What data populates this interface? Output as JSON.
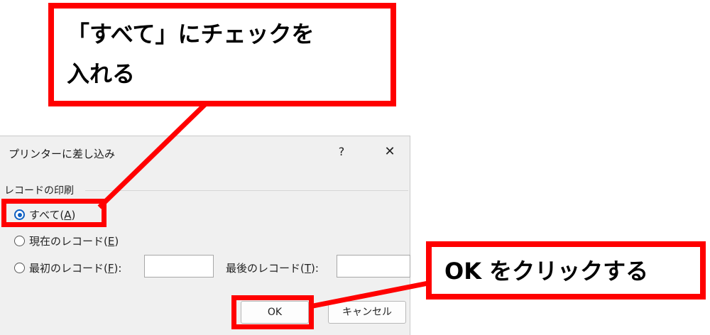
{
  "dialog": {
    "title": "プリンターに差し込み",
    "help_label": "?",
    "close_label": "✕",
    "group_label": "レコードの印刷",
    "options": {
      "all": {
        "label_prefix": "すべて(",
        "key": "A",
        "label_suffix": ")",
        "selected": true
      },
      "current": {
        "label_prefix": "現在のレコード(",
        "key": "E",
        "label_suffix": ")",
        "selected": false
      },
      "range": {
        "label_prefix": "最初のレコード(",
        "key": "F",
        "label_suffix": "):",
        "selected": false
      }
    },
    "last_record_label_prefix": "最後のレコード(",
    "last_record_key": "T",
    "last_record_label_suffix": "):",
    "first_value": "",
    "last_value": "",
    "ok_label": "OK",
    "cancel_label": "キャンセル"
  },
  "callouts": {
    "top_line1": "「すべて」にチェックを",
    "top_line2": "入れる",
    "right": "OK をクリックする"
  },
  "colors": {
    "callout_red": "#ff0000",
    "radio_blue": "#0d5fc2",
    "dialog_bg": "#f0f0f0"
  }
}
